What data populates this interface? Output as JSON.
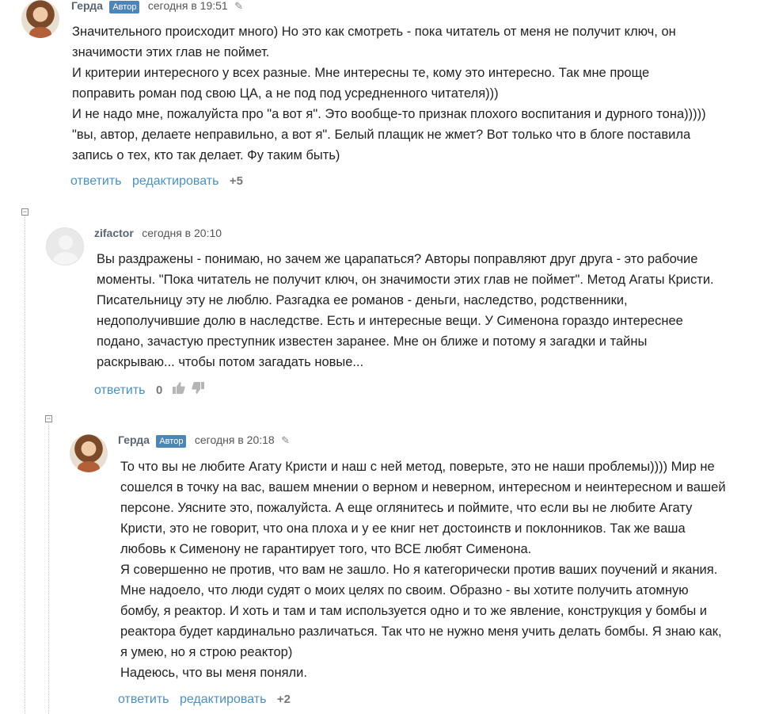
{
  "comments": [
    {
      "author": "Герда",
      "badge": "Автор",
      "time": "сегодня в 19:51",
      "lines": [
        "Значительного происходит много) Но это как смотреть - пока читатель от меня не получит ключ, он",
        "значимости этих глав не поймет.",
        "И критерии интересного у всех разные. Мне интересны те, кому это интересно.  Так мне проще",
        " поправить роман под свою ЦА, а не под под усредненного читателя)))",
        " И не надо мне, пожалуйста про \"а вот я\". Это вообще-то признак плохого воспитания и дурного тона)))))",
        "\"вы, автор, делаете неправильно, а вот я\". Белый плащик не жмет? Вот только что в блоге поставила",
        "запись о тех, кто  так делает. Фу таким быть)"
      ],
      "reply": "ответить",
      "edit": "редактировать",
      "score": "+5"
    },
    {
      "author": "zifactor",
      "time": "сегодня в 20:10",
      "lines": [
        "Вы раздражены - понимаю, но зачем же царапаться? Авторы поправляют друг друга - это рабочие",
        "моменты. \"Пока читатель не получит ключ, он значимости этих глав не поймет\". Метод Агаты Кристи.",
        "Писательницу эту не люблю. Разгадка ее романов - деньги, наследство, родственники,",
        "недополучившие долю в наследстве. Есть и интересные вещи. У Сименона гораздо интереснее",
        "подано, зачастую преступник известен заранее. Мне он ближе и потому я загадки и тайны",
        "раскрываю... чтобы потом загадать новые..."
      ],
      "reply": "ответить",
      "score": "0"
    },
    {
      "author": "Герда",
      "badge": "Автор",
      "time": "сегодня в 20:18",
      "lines": [
        "То что вы не любите Агату Кристи и наш с ней метод, поверьте, это не наши проблемы)))) Мир не",
        "сошелся в точку на вас, вашем мнении о верном и неверном, интересном и неинтересном и вашей",
        "персоне.  Уясните это, пожалуйста. А еще оглянитесь и поймите, что если вы не любите  Агату",
        "Кристи, это не говорит, что она плоха и у ее книг нет достоинств и поклонников. Так же ваша",
        "любовь к Сименону не гарантирует того, что ВСЕ любят Сименона.",
        "Я совершенно не против, что вам не зашло. Но я категорически против ваших поучений и якания.",
        "Мне надоело, что люди судят о моих целях по своим. Образно - вы хотите получить атомную",
        "бомбу, я реактор. И хоть и там и там используется одно и то же явление, конструкция у бомбы и",
        "реактора будет кардинально различаться. Так что не нужно меня учить делать бомбы. Я знаю как,",
        "я умею, но я строю реактор)",
        "Надеюсь, что вы меня поняли."
      ],
      "reply": "ответить",
      "edit": "редактировать",
      "score": "+2"
    }
  ],
  "icons": {
    "pencil": "pencil-icon",
    "collapse": "collapse-toggle-icon",
    "like": "thumbs-up-icon",
    "dislike": "thumbs-down-icon"
  },
  "colors": {
    "link": "#4b8fbc",
    "badge": "#4d86b6",
    "author": "#5b6673"
  }
}
